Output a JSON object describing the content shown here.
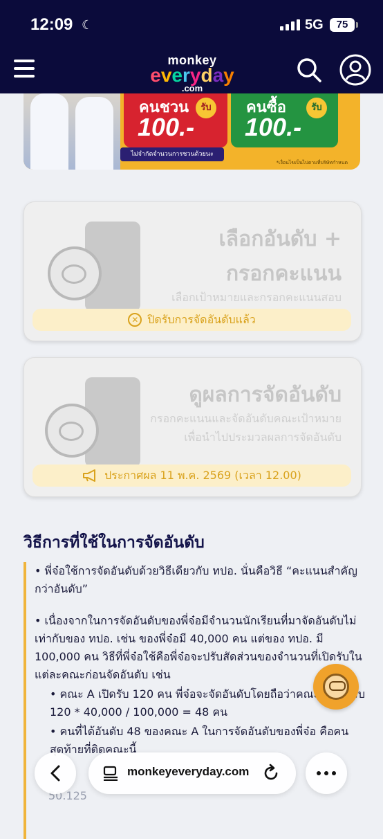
{
  "status_bar": {
    "time": "12:09",
    "network": "5G",
    "battery": "75"
  },
  "header": {
    "logo_top": "monkey",
    "logo_mid": [
      "e",
      "v",
      "e",
      "r",
      "y",
      "d",
      "a",
      "y"
    ],
    "logo_bottom": ".com"
  },
  "banner": {
    "ticket_invite_label": "คนชวน",
    "ticket_buy_label": "คนซื้อ",
    "rub_label": "รับ",
    "invite_amount": "100.-",
    "buy_amount": "100.-",
    "note": "ไม่จำกัดจำนวนการชวนด้วยนะ",
    "footnote": "*เงื่อนไขเป็นไปตามที่บริษัทกำหนด"
  },
  "card1": {
    "title_line1": "เลือกอันดับ +",
    "title_line2": "กรอกคะแนน",
    "subtitle": "เลือกเป้าหมายและกรอกคะแนนสอบ",
    "status": "ปิดรับการจัดอันดับแล้ว"
  },
  "card2": {
    "title": "ดูผลการจัดอันดับ",
    "subtitle_line1": "กรอกคะแนนและจัดอันดับคณะเป้าหมาย",
    "subtitle_line2": "เพื่อนำไปประมวลผลการจัดอันดับ",
    "status": "ประกาศผล 11 พ.ค. 2569 (เวลา 12.00)"
  },
  "section": {
    "title": "วิธีการที่ใช้ในการจัดอันดับ",
    "para1": "• พี่จ๋อใช้การจัดอันดับด้วยวิธีเดียวกับ ทปอ. นั่นคือวิธี “คะแนนสำคัญกว่าอันดับ”",
    "para2": "• เนื่องจากในการจัดอันดับของพี่จ๋อมีจำนวนนักเรียนที่มาจัดอันดับไม่เท่ากับของ ทปอ. เช่น ของพี่จ๋อมี 40,000 คน แต่ของ ทปอ. มี 100,000 คน วิธีที่พี่จ๋อใช้คือพี่จ๋อจะปรับสัดส่วนของจำนวนที่เปิดรับในแต่ละคณะก่อนจัดอันดับ เช่น",
    "sub1": "• คณะ A เปิดรับ 120 คน พี่จ๋อจะจัดอันดับโดยถือว่าคณะ A เปิดรับ 120 * 40,000 / 100,000 = 48 คน",
    "sub2": "• คนที่ได้อันดับ 48 ของคณะ A ในการจัดอันดับของพี่จ๋อ คือคนสุดท้ายที่ติดคณะนี้",
    "tail": "50.125"
  },
  "browser": {
    "url": "monkeyeveryday.com"
  }
}
